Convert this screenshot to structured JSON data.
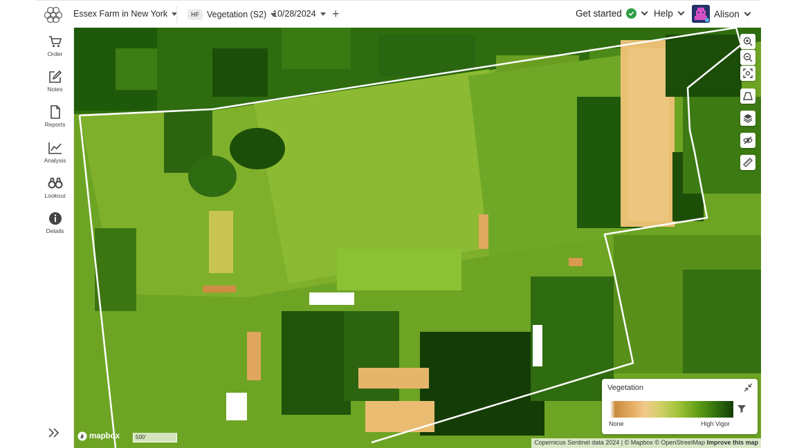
{
  "topbar": {
    "farm_name": "Essex Farm in New York",
    "layer_badge": "HF",
    "layer_name": "Vegetation (S2)",
    "date": "10/28/2024",
    "add_label": "+",
    "get_started": "Get started",
    "help": "Help",
    "user_name": "Alison"
  },
  "sidebar": {
    "items": [
      {
        "label": "Order",
        "icon": "cart-icon"
      },
      {
        "label": "Notes",
        "icon": "edit-icon"
      },
      {
        "label": "Reports",
        "icon": "document-icon"
      },
      {
        "label": "Analysis",
        "icon": "chart-icon"
      },
      {
        "label": "Lookout",
        "icon": "binoculars-icon"
      },
      {
        "label": "Details",
        "icon": "info-icon"
      }
    ],
    "expand_icon": "double-chevron-right-icon"
  },
  "map_tools": [
    {
      "name": "zoom-in",
      "icon": "zoom-in-icon"
    },
    {
      "name": "zoom-out",
      "icon": "zoom-out-icon"
    },
    {
      "name": "fit-bounds",
      "icon": "fit-bounds-icon"
    },
    {
      "name": "tilt",
      "icon": "perspective-icon"
    },
    {
      "name": "layers",
      "icon": "layers-icon"
    },
    {
      "name": "hide-overlay",
      "icon": "eye-off-icon"
    },
    {
      "name": "measure",
      "icon": "ruler-icon"
    }
  ],
  "legend": {
    "title": "Vegetation",
    "min_label": "None",
    "max_label": "High Vigor"
  },
  "map": {
    "logo_text": "mapbox",
    "scale_label": "500'",
    "attribution": "Copernicus Sentinel data 2024 | © Mapbox © OpenStreetMap",
    "improve_link": "Improve this map"
  },
  "colors": {
    "check_green": "#2e9e44",
    "boundary": "#ffffff"
  }
}
